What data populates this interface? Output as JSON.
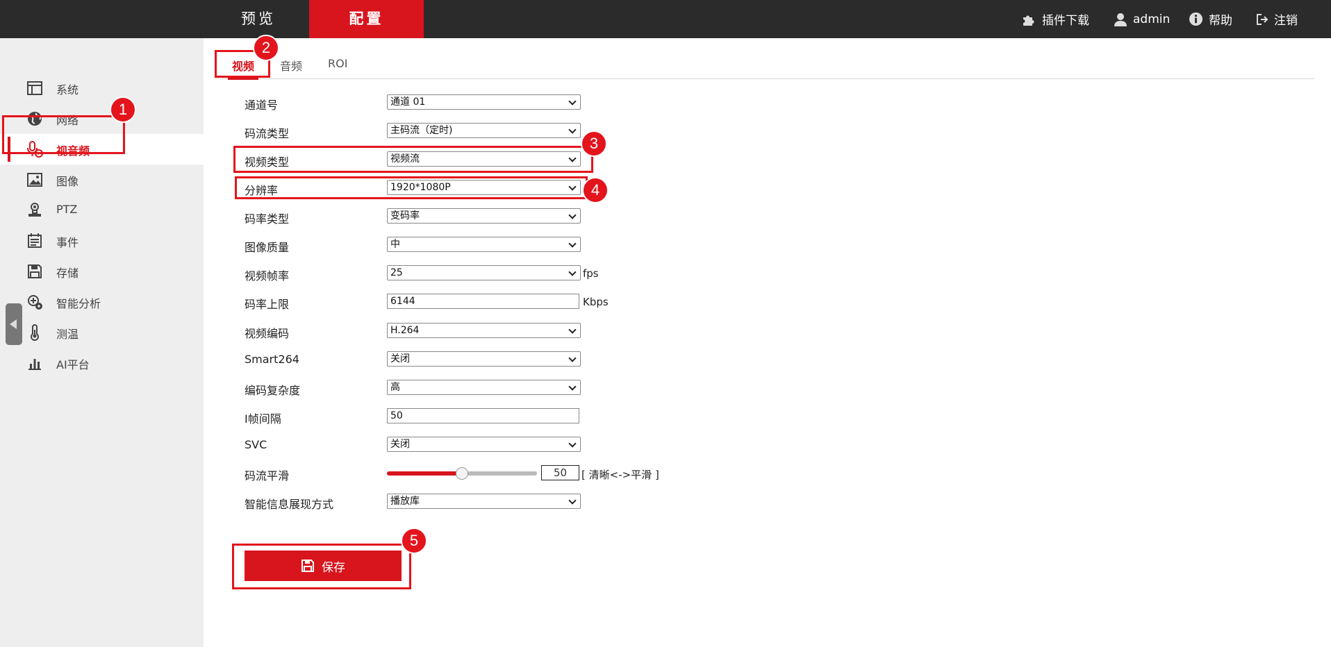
{
  "topbar": {
    "tabs": [
      {
        "label": "预览"
      },
      {
        "label": "配置"
      }
    ],
    "plugin_label": "插件下载",
    "user_label": "admin",
    "help_label": "帮助",
    "logout_label": "注销"
  },
  "sidebar": {
    "items": [
      {
        "label": "系统",
        "icon": "system-icon"
      },
      {
        "label": "网络",
        "icon": "globe-icon"
      },
      {
        "label": "视音频",
        "icon": "microphone-icon"
      },
      {
        "label": "图像",
        "icon": "image-icon"
      },
      {
        "label": "PTZ",
        "icon": "ptz-icon"
      },
      {
        "label": "事件",
        "icon": "calendar-icon"
      },
      {
        "label": "存储",
        "icon": "save-icon"
      },
      {
        "label": "智能分析",
        "icon": "smart-analysis-icon"
      },
      {
        "label": "测温",
        "icon": "thermometer-icon"
      },
      {
        "label": "AI平台",
        "icon": "bar-chart-icon"
      }
    ]
  },
  "subtabs": {
    "video": "视频",
    "audio": "音频",
    "roi": "ROI"
  },
  "form": {
    "channel": {
      "label": "通道号",
      "value": "通道 01"
    },
    "stream_type": {
      "label": "码流类型",
      "value": "主码流（定时)"
    },
    "video_type": {
      "label": "视频类型",
      "value": "视频流"
    },
    "resolution": {
      "label": "分辨率",
      "value": "1920*1080P"
    },
    "bitrate_type": {
      "label": "码率类型",
      "value": "变码率"
    },
    "image_quality": {
      "label": "图像质量",
      "value": "中"
    },
    "frame_rate": {
      "label": "视频帧率",
      "value": "25",
      "unit": "fps"
    },
    "max_bitrate": {
      "label": "码率上限",
      "value": "6144",
      "unit": "Kbps"
    },
    "video_encoding": {
      "label": "视频编码",
      "value": "H.264"
    },
    "smart264": {
      "label": "Smart264",
      "value": "关闭"
    },
    "complexity": {
      "label": "编码复杂度",
      "value": "高"
    },
    "i_frame_interval": {
      "label": "I帧间隔",
      "value": "50"
    },
    "svc": {
      "label": "SVC",
      "value": "关闭"
    },
    "smoothing": {
      "label": "码流平滑",
      "value": 50,
      "display": "50",
      "hint": "[ 清晰<->平滑 ]"
    },
    "smart_info": {
      "label": "智能信息展现方式",
      "value": "播放库"
    }
  },
  "save_label": "保存",
  "annotations": [
    "1",
    "2",
    "3",
    "4",
    "5"
  ],
  "colors": {
    "accent": "#d8141d",
    "topbar": "#2b2b2b",
    "sidebar": "#eeeeee"
  }
}
